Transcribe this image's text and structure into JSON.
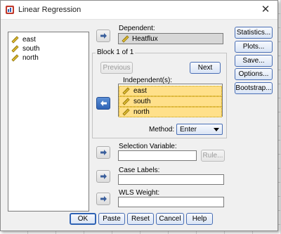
{
  "window": {
    "title": "Linear Regression",
    "close_glyph": "✕"
  },
  "source_variables": [
    "east",
    "south",
    "north"
  ],
  "dependent": {
    "label": "Dependent:",
    "value": "Heatflux"
  },
  "block": {
    "label": "Block 1 of 1",
    "previous": "Previous",
    "next": "Next"
  },
  "independent": {
    "label": "Independent(s):",
    "items": [
      "east",
      "south",
      "north"
    ]
  },
  "method": {
    "label": "Method:",
    "value": "Enter"
  },
  "selection_variable": {
    "label": "Selection Variable:",
    "rule_button": "Rule..."
  },
  "case_labels": {
    "label": "Case Labels:"
  },
  "wls_weight": {
    "label": "WLS Weight:"
  },
  "side_buttons": [
    "Statistics...",
    "Plots...",
    "Save...",
    "Options...",
    "Bootstrap..."
  ],
  "bottom_buttons": [
    "OK",
    "Paste",
    "Reset",
    "Cancel",
    "Help"
  ],
  "colors": {
    "selection": "#ffe08a",
    "accent_blue": "#2f63b5",
    "variable_icon": "#c9a100"
  },
  "icons": {
    "variable": "ruler-icon",
    "arrow": "right-arrow-icon",
    "app": "spss-app-icon"
  }
}
